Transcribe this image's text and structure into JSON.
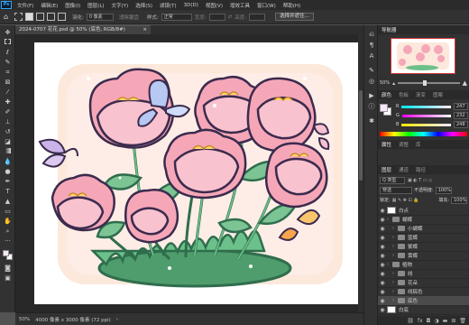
{
  "menubar": {
    "logo": "Ps",
    "items": [
      "文件(F)",
      "编辑(E)",
      "图像(I)",
      "图层(L)",
      "文字(Y)",
      "选择(S)",
      "滤镜(T)",
      "3D(D)",
      "视图(V)",
      "增效工具",
      "窗口(W)",
      "帮助(H)"
    ]
  },
  "options": {
    "feather_label": "羽化:",
    "feather_value": "0 像素",
    "antialias_label": "消除锯齿",
    "style_label": "样式:",
    "style_value": "正常",
    "width_label": "宽度:",
    "height_label": "高度:",
    "select_mask_button": "选择并遮住..."
  },
  "document": {
    "tab_title": "2024-0707 花花.psd @ 50% (底色, RGB/8#)",
    "close": "×"
  },
  "status": {
    "zoom": "50%",
    "doc_info": "4000 像素 x 3000 像素 (72 ppi)",
    "arrow": "›"
  },
  "navigator": {
    "tabs": [
      "导航器"
    ],
    "zoom_value": "50%"
  },
  "color_panel": {
    "tabs": [
      "颜色",
      "色板",
      "渐变",
      "图案"
    ],
    "channels": [
      {
        "label": "R",
        "value": "247",
        "color": "#f7e8f8"
      },
      {
        "label": "G",
        "value": "232",
        "color": "#e8f7e8"
      },
      {
        "label": "B",
        "value": "248",
        "color": "#e8e8f8"
      }
    ],
    "foreground": "#f7e8f8",
    "background": "#ffffff"
  },
  "adjust_panel": {
    "tabs": [
      "属性",
      "调整",
      "库"
    ]
  },
  "layers_panel": {
    "tabs": [
      "图层",
      "通道",
      "路径"
    ],
    "filter_label": "Q 类型",
    "blend_mode": "穿透",
    "opacity_label": "不透明度:",
    "opacity_value": "100%",
    "lock_label": "锁定:",
    "fill_label": "填充:",
    "fill_value": "100%",
    "layers": [
      {
        "name": "白点",
        "kind": "layer",
        "indent": 0,
        "thumb": "#ffffff"
      },
      {
        "name": "蝴蝶",
        "kind": "group",
        "indent": 0
      },
      {
        "name": "小蝴蝶",
        "kind": "group",
        "indent": 1
      },
      {
        "name": "蓝蝶",
        "kind": "group",
        "indent": 1
      },
      {
        "name": "紫蝶",
        "kind": "group",
        "indent": 1
      },
      {
        "name": "黄蝶",
        "kind": "group",
        "indent": 1
      },
      {
        "name": "植物",
        "kind": "group",
        "indent": 0
      },
      {
        "name": "线",
        "kind": "group",
        "indent": 1
      },
      {
        "name": "花朵",
        "kind": "group",
        "indent": 1
      },
      {
        "name": "线稿色",
        "kind": "group",
        "indent": 1
      },
      {
        "name": "底色",
        "kind": "group",
        "indent": 1,
        "selected": true
      },
      {
        "name": "白底",
        "kind": "layer",
        "indent": 0,
        "thumb": "#ffffff"
      }
    ]
  },
  "colors": {
    "accent": "#31a8ff",
    "panel_bg": "#323232",
    "canvas_bg": "#282828"
  }
}
